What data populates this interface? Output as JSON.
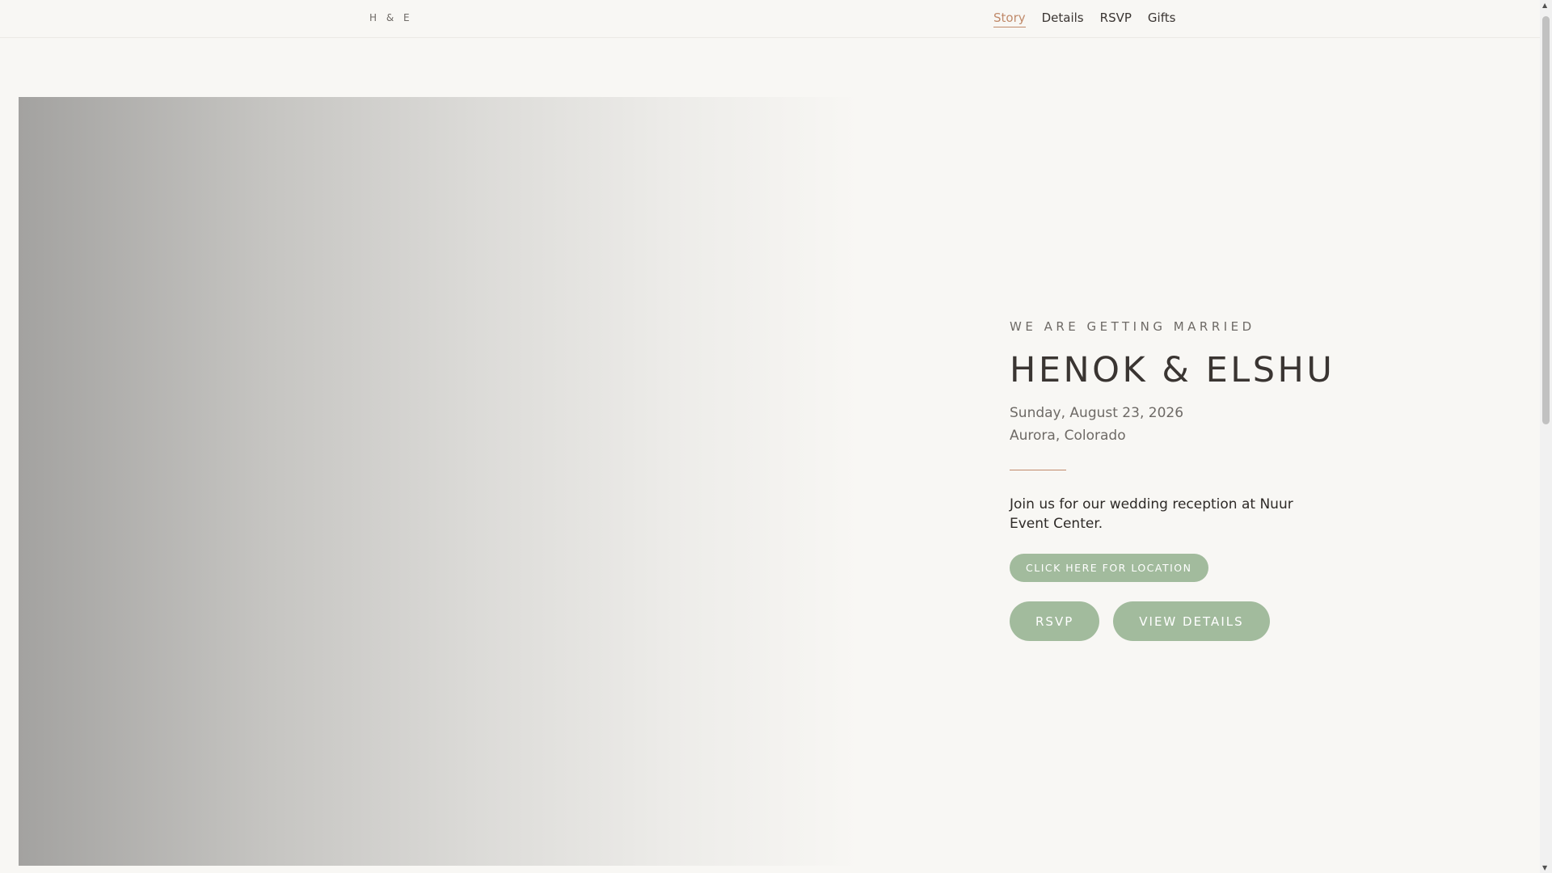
{
  "nav": {
    "logo": "H & E",
    "links": [
      {
        "label": "Story",
        "active": true
      },
      {
        "label": "Details"
      },
      {
        "label": "RSVP"
      },
      {
        "label": "Gifts"
      }
    ]
  },
  "hero": {
    "eyebrow": "WE ARE GETTING MARRIED",
    "title": "HENOK & ELSHU",
    "date": "Sunday, August 23, 2026",
    "location": "Aurora, Colorado",
    "message": "Join us for our wedding reception at Nuur Event Center.",
    "location_button": "CLICK HERE FOR LOCATION",
    "rsvp_button": "RSVP",
    "details_button": "VIEW DETAILS"
  },
  "colors": {
    "accent": "#c08a6a",
    "button": "#a2bb9d",
    "background": "#f8f7f4"
  }
}
